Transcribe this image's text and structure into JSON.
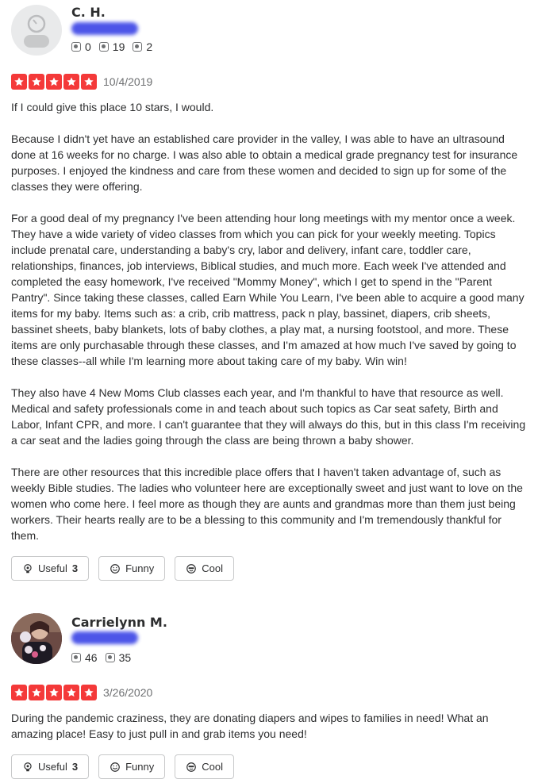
{
  "reviews": [
    {
      "user_name": "C. H.",
      "stats": [
        {
          "icon": "review-count-icon",
          "value": "0"
        },
        {
          "icon": "star-count-icon",
          "value": "19"
        },
        {
          "icon": "photo-count-icon",
          "value": "2"
        }
      ],
      "rating": 5,
      "date": "10/4/2019",
      "paragraphs": [
        "If I could give this place 10 stars, I would.",
        "Because I didn't yet have an established care provider in the valley, I was able to have an ultrasound done at 16 weeks for no charge. I was also able to obtain a medical grade pregnancy test for insurance purposes. I enjoyed the kindness and care from these women and decided to sign up for some of the classes they were offering.",
        "For a good deal of my pregnancy I've been attending hour long meetings with my mentor once a week. They have a wide variety of video classes from which you can pick for your weekly meeting. Topics include prenatal care, understanding a baby's cry, labor and delivery, infant care, toddler care, relationships, finances, job interviews, Biblical studies, and much more. Each week I've attended and completed the easy homework, I've received \"Mommy Money\", which I get to spend in the \"Parent Pantry\". Since taking these classes, called Earn While You Learn, I've been able to acquire a good many items for my baby. Items such as: a crib, crib mattress, pack n play, bassinet, diapers, crib sheets, bassinet sheets, baby blankets, lots of baby clothes, a play mat, a nursing footstool, and more. These items are only purchasable through these classes, and I'm amazed at how much I've saved by going to these classes--all while I'm learning more about taking care of my baby. Win win!",
        "They also have 4 New Moms Club classes each year, and I'm thankful to have that resource as well. Medical and safety professionals come in and teach about such topics as Car seat safety, Birth and Labor, Infant CPR, and more. I can't guarantee that they will always do this, but in this class I'm receiving a car seat and the ladies going through the class are being thrown a baby shower.",
        "There are other resources that this incredible place offers that I haven't taken advantage of, such as weekly Bible studies. The ladies who volunteer here are exceptionally sweet and just want to love on the women who come here. I feel more as though they are aunts and grandmas more than them just being workers. Their hearts really are to be a blessing to this community and I'm tremendously thankful for them."
      ],
      "reactions": {
        "useful_label": "Useful",
        "useful_count": "3",
        "funny_label": "Funny",
        "cool_label": "Cool"
      }
    },
    {
      "user_name": "Carrielynn M.",
      "stats": [
        {
          "icon": "review-count-icon",
          "value": "46"
        },
        {
          "icon": "star-count-icon",
          "value": "35"
        }
      ],
      "rating": 5,
      "date": "3/26/2020",
      "paragraphs": [
        "During the pandemic craziness, they are donating diapers and wipes to families in need! What an amazing place! Easy to just pull in and grab items you need!"
      ],
      "reactions": {
        "useful_label": "Useful",
        "useful_count": "3",
        "funny_label": "Funny",
        "cool_label": "Cool"
      }
    }
  ],
  "colors": {
    "star_red": "#f43939",
    "text": "#2d2e2f",
    "muted": "#6e7072",
    "location_blur": "#3a43e6"
  }
}
